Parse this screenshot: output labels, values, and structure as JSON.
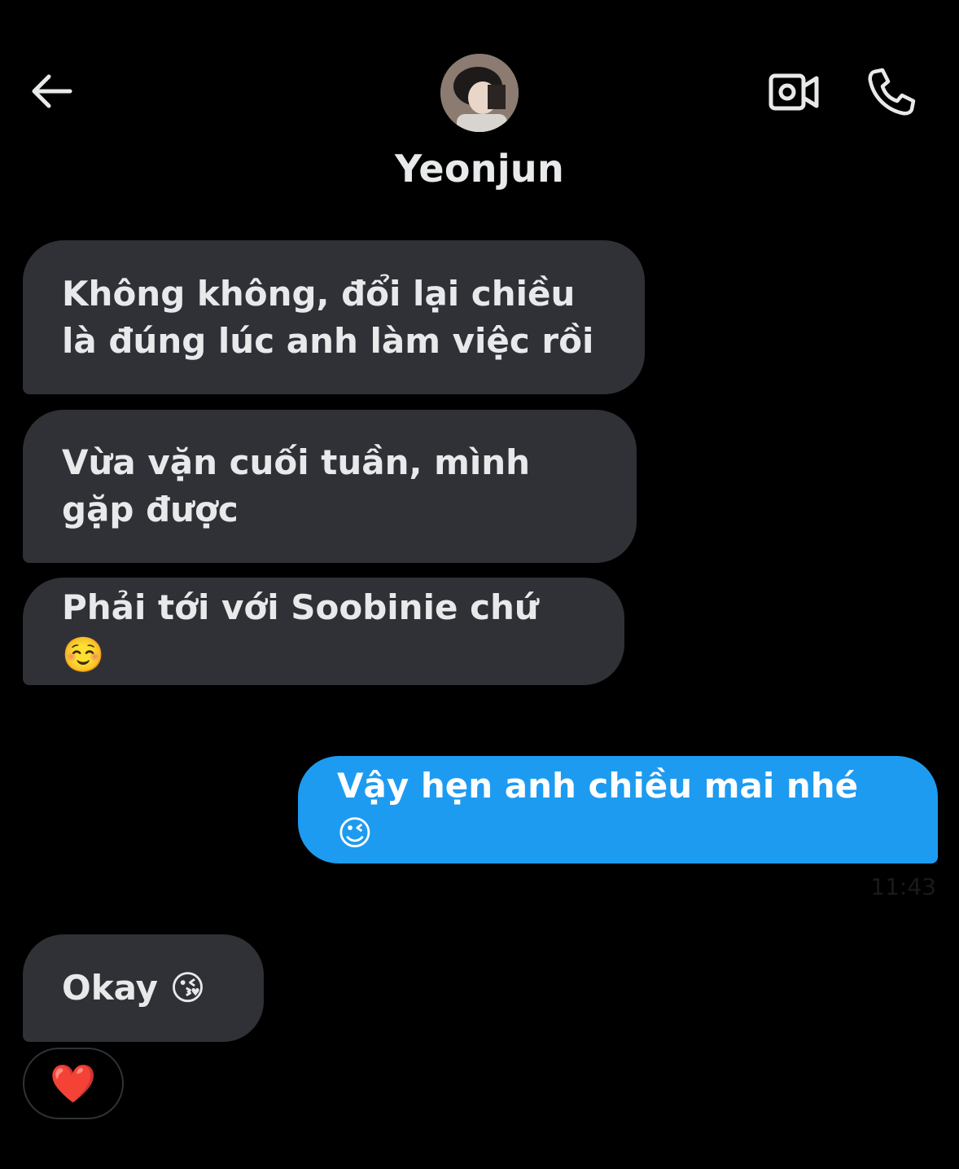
{
  "header": {
    "back_icon": "arrow-left-icon",
    "contact_name": "Yeonjun",
    "video_icon": "video-camera-icon",
    "call_icon": "phone-icon"
  },
  "colors": {
    "background": "#000000",
    "incoming_bubble": "#2f3136",
    "outgoing_bubble": "#1d9bf0",
    "text": "#e7e9ea"
  },
  "messages": [
    {
      "direction": "incoming",
      "text": "Không không, đổi lại chiều là đúng lúc anh làm việc rồi"
    },
    {
      "direction": "incoming",
      "text": "Vừa vặn cuối tuần, mình gặp được"
    },
    {
      "direction": "incoming",
      "text": "Phải tới với Soobinie chứ ☺️"
    },
    {
      "direction": "outgoing",
      "text": "Vậy hẹn anh chiều mai nhé 😉",
      "time": "11:43"
    },
    {
      "direction": "incoming",
      "text": "Okay 😘",
      "reaction": "❤️"
    }
  ]
}
